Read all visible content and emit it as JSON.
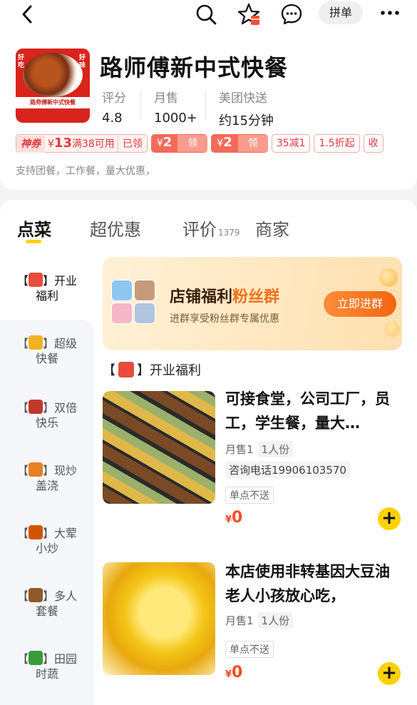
{
  "topbar": {
    "pindan_label": "拼单"
  },
  "shop": {
    "name": "路师傅新中式快餐",
    "logo_banner": "路师傅新中式快餐",
    "logo_left": "好吃",
    "logo_right": "好味",
    "stats": [
      {
        "label": "评分",
        "value": "4.8"
      },
      {
        "label": "月售",
        "value": "1000+"
      },
      {
        "label": "美团快送",
        "value": "约15分钟"
      }
    ],
    "coupons": {
      "god": {
        "tag": "神券",
        "currency": "¥",
        "amount": "13",
        "cond": "满38可用",
        "status": "已领"
      },
      "red": [
        {
          "currency": "¥",
          "amount": "2",
          "action": "领"
        },
        {
          "currency": "¥",
          "amount": "2",
          "action": "领"
        }
      ],
      "outline": [
        "35减1",
        "1.5折起",
        "收"
      ]
    },
    "description": "支持团餐，工作餐，量大优惠，"
  },
  "tabs": [
    {
      "label": "点菜",
      "count": ""
    },
    {
      "label": "超优惠",
      "count": ""
    },
    {
      "label": "评价",
      "count": "1379"
    },
    {
      "label": "商家",
      "count": ""
    }
  ],
  "categories": [
    {
      "bracket_open": "【",
      "bracket_close": "】",
      "line1": "开业",
      "line2": "福利",
      "icon": "gift-icon",
      "color": "#e74c3c"
    },
    {
      "bracket_open": "【",
      "bracket_close": "】",
      "line1": "超级",
      "line2": "快餐",
      "icon": "trophy-icon",
      "color": "#f0b323"
    },
    {
      "bracket_open": "【",
      "bracket_close": "】",
      "line1": "双倍",
      "line2": "快乐",
      "icon": "meat-icon",
      "color": "#c0392b"
    },
    {
      "bracket_open": "【",
      "bracket_close": "】",
      "line1": "现炒",
      "line2": "盖浇",
      "icon": "curry-icon",
      "color": "#e67e22"
    },
    {
      "bracket_open": "【",
      "bracket_close": "】",
      "line1": "大荤",
      "line2": "小炒",
      "icon": "drumstick-icon",
      "color": "#d35400"
    },
    {
      "bracket_open": "【",
      "bracket_close": "】",
      "line1": "多人",
      "line2": "套餐",
      "icon": "bento-icon",
      "color": "#8e5a2c"
    },
    {
      "bracket_open": "【",
      "bracket_close": "】",
      "line1": "田园",
      "line2": "时蔬",
      "icon": "broccoli-icon",
      "color": "#3a9a3a"
    }
  ],
  "banner": {
    "title_a": "店铺福利",
    "title_b": "粉丝群",
    "subtitle": "进群享受粉丝群专属优惠",
    "button": "立即进群"
  },
  "section": {
    "open": "【",
    "close": "】",
    "title": "开业福利"
  },
  "dishes": [
    {
      "name": "可接食堂，公司工厂，员工，学生餐，量大…",
      "monthly_sales": "月售1",
      "portion": "1人份",
      "phone": "咨询电话19906103570",
      "tag": "单点不送",
      "currency": "¥",
      "price": "0"
    },
    {
      "name": "本店使用非转基因大豆油老人小孩放心吃，",
      "monthly_sales": "月售1",
      "portion": "1人份",
      "phone": "",
      "tag": "单点不送",
      "currency": "¥",
      "price": "0"
    }
  ],
  "colors": {
    "accent_yellow": "#ffd100",
    "price_red": "#ff4a26",
    "coupon_red": "#f46a5a",
    "banner_orange": "#f5701a"
  }
}
